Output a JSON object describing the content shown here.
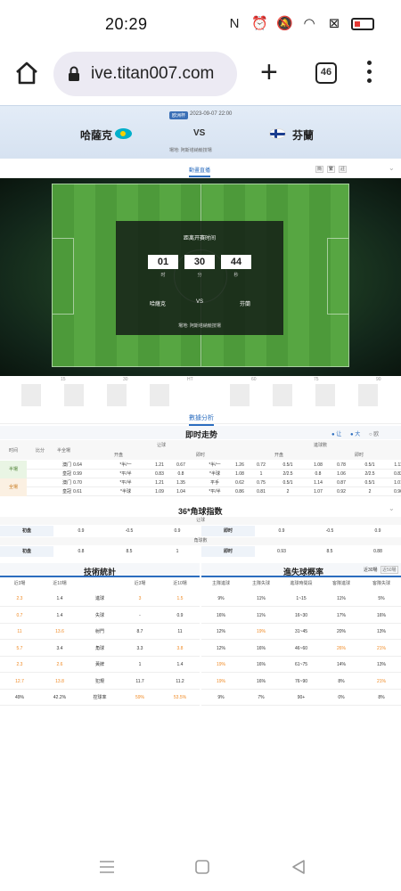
{
  "status_bar": {
    "time": "20:29",
    "battery_color": "#e53935"
  },
  "browser": {
    "url": "ive.titan007.com",
    "tab_count": "46"
  },
  "match": {
    "competition": "欧洲杯",
    "datetime": "2023-09-07 22:00",
    "home": "哈薩克",
    "away": "芬蘭",
    "vs": "VS",
    "venue": "場地: 阿斯塔納競技場"
  },
  "anim_tab": {
    "label": "動畫直播",
    "mini_buttons": [
      "簡",
      "繁",
      "註"
    ]
  },
  "countdown": {
    "title": "距离开赛时间",
    "hours": "01",
    "minutes": "30",
    "seconds": "44",
    "unit_h": "时",
    "unit_m": "分",
    "unit_s": "秒",
    "home": "哈薩克",
    "vs": "VS",
    "away": "芬蘭",
    "venue": "場地: 阿斯塔納競技場"
  },
  "timeline_ticks": [
    "15",
    "30",
    "HT",
    "60",
    "75",
    "90"
  ],
  "analysis_tab": "數據分析",
  "live_trend": {
    "title": "即时走势",
    "legend": [
      "让",
      "大",
      "欧"
    ],
    "col_time": "时间",
    "col_score": "比分",
    "col_company": "半全場",
    "handicap_header": "让球",
    "ou_header": "進球數",
    "open": "开盘",
    "live": "即时",
    "rows": [
      {
        "period": "半場",
        "company": "澳门",
        "h": [
          "0.64",
          "*半/一",
          "1.21",
          "0.67",
          "*半/一",
          "1.26"
        ],
        "o": [
          "0.72",
          "0.5/1",
          "1.08",
          "0.78",
          "0.5/1",
          "1.11"
        ]
      },
      {
        "period": "",
        "company": "皇冠",
        "h": [
          "0.99",
          "*平/半",
          "0.83",
          "0.8",
          "*半球",
          "1.08"
        ],
        "o": [
          "1",
          "2/2.5",
          "0.8",
          "1.06",
          "2/2.5",
          "0.82"
        ]
      },
      {
        "period": "全場",
        "company": "澳门",
        "h": [
          "0.70",
          "*平/半",
          "1.21",
          "1.35",
          "平手",
          "0.62"
        ],
        "o": [
          "0.75",
          "0.5/1",
          "1.14",
          "0.87",
          "0.5/1",
          "1.01"
        ]
      },
      {
        "period": "",
        "company": "皇冠",
        "h": [
          "0.61",
          "*半球",
          "1.09",
          "1.04",
          "*平/半",
          "0.86"
        ],
        "o": [
          "0.81",
          "2",
          "1.07",
          "0.92",
          "2",
          "0.96"
        ]
      }
    ]
  },
  "corner_index": {
    "title": "36*角球指数",
    "handicap_header": "让球",
    "ou_header": "角球數",
    "rows": [
      {
        "label": "初盘",
        "a": [
          "0.9",
          "-0.5",
          "0.9"
        ],
        "live": "即时",
        "b": [
          "0.9",
          "-0.5",
          "0.9"
        ]
      },
      {
        "label": "初盘",
        "a": [
          "0.8",
          "8.5",
          "1"
        ],
        "live": "即时",
        "b": [
          "0.93",
          "8.5",
          "0.88"
        ]
      }
    ]
  },
  "tech_stats": {
    "title": "技術統計",
    "headers": [
      "近3場",
      "近10場",
      "",
      "近3場",
      "近10場"
    ],
    "rows": [
      [
        "2.3",
        "1.4",
        "進球",
        "3",
        "1.5"
      ],
      [
        "0.7",
        "1.4",
        "失球",
        "-",
        "0.9"
      ],
      [
        "11",
        "13.6",
        "射門",
        "8.7",
        "11"
      ],
      [
        "5.7",
        "3.4",
        "角球",
        "3.3",
        "3.8"
      ],
      [
        "2.3",
        "2.6",
        "黃牌",
        "1",
        "1.4"
      ],
      [
        "12.7",
        "13.8",
        "犯規",
        "11.7",
        "11.2"
      ],
      [
        "49%",
        "42.2%",
        "控球率",
        "59%",
        "53.5%"
      ]
    ]
  },
  "goal_prob": {
    "title": "進失球概率",
    "buttons": [
      "近30場",
      "近50場"
    ],
    "headers": [
      "主隊進球",
      "主隊失球",
      "進球時間段",
      "客隊進球",
      "客隊失球"
    ],
    "rows": [
      [
        "9%",
        "11%",
        "1~15",
        "11%",
        "5%"
      ],
      [
        "16%",
        "11%",
        "16~30",
        "17%",
        "16%"
      ],
      [
        "12%",
        "19%",
        "31~45",
        "20%",
        "13%"
      ],
      [
        "12%",
        "16%",
        "46~60",
        "26%",
        "21%"
      ],
      [
        "19%",
        "16%",
        "61~75",
        "14%",
        "13%"
      ],
      [
        "19%",
        "16%",
        "76~90",
        "8%",
        "21%"
      ],
      [
        "9%",
        "7%",
        "90+",
        "0%",
        "8%"
      ]
    ]
  }
}
